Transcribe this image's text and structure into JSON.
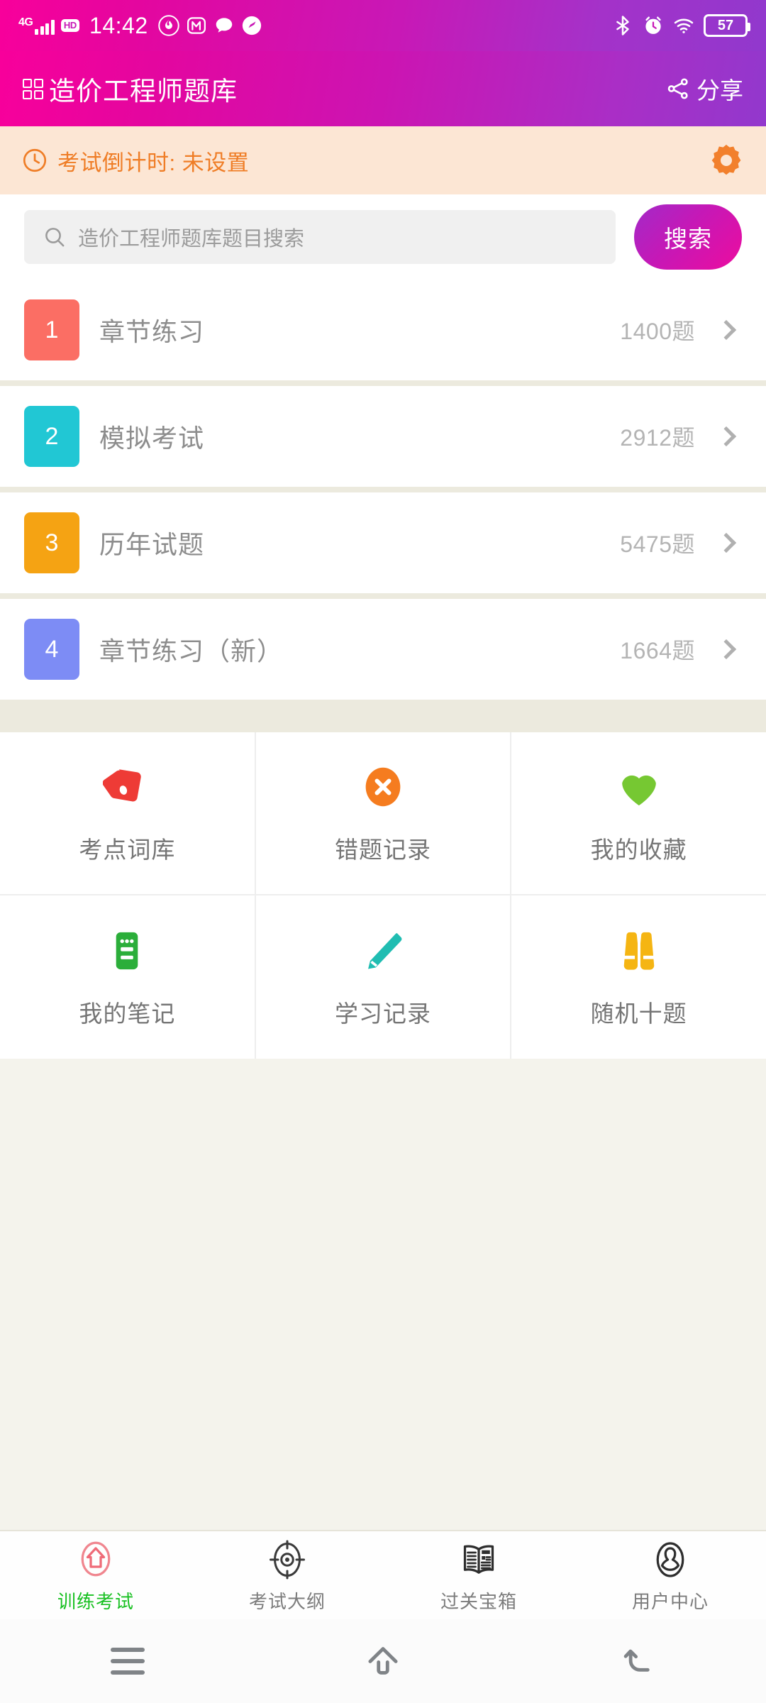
{
  "status_bar": {
    "network_type": "4G",
    "hd_label": "HD",
    "time": "14:42",
    "battery_level": "57",
    "icons": [
      "signal-bars-icon",
      "hd-icon",
      "flame-app-icon",
      "m-app-icon",
      "chat-bubble-icon",
      "speedometer-icon",
      "bluetooth-icon",
      "alarm-clock-icon",
      "wifi-icon",
      "battery-icon"
    ]
  },
  "app_bar": {
    "title": "造价工程师题库",
    "menu_icon": "grid-apps-icon",
    "share_label": "分享",
    "share_icon": "share-nodes-icon",
    "gradient_start": "#F8009B",
    "gradient_end": "#9138CD"
  },
  "countdown": {
    "text": "考试倒计时: 未设置",
    "clock_icon": "clock-icon",
    "settings_icon": "gear-icon",
    "bg_color": "#FCE6D4",
    "text_color": "#EF7D26"
  },
  "search": {
    "placeholder": "造价工程师题库题目搜索",
    "value": "",
    "icon": "search-icon",
    "button_label": "搜索"
  },
  "list": {
    "items": [
      {
        "index": "1",
        "title": "章节练习",
        "count": "1400题",
        "color": "#FB6E64"
      },
      {
        "index": "2",
        "title": "模拟考试",
        "count": "2912题",
        "color": "#21C7D4"
      },
      {
        "index": "3",
        "title": "历年试题",
        "count": "5475题",
        "color": "#F5A313"
      },
      {
        "index": "4",
        "title": "章节练习（新）",
        "count": "1664题",
        "color": "#7D8CF5"
      }
    ]
  },
  "grid": {
    "rows": [
      [
        {
          "label": "考点词库",
          "icon": "price-tag-icon",
          "color": "#EE3B36"
        },
        {
          "label": "错题记录",
          "icon": "circle-x-icon",
          "color": "#F57C1F"
        },
        {
          "label": "我的收藏",
          "icon": "heart-icon",
          "color": "#76C832"
        }
      ],
      [
        {
          "label": "我的笔记",
          "icon": "notepad-icon",
          "color": "#2BAE3A"
        },
        {
          "label": "学习记录",
          "icon": "pencil-icon",
          "color": "#20BDB2"
        },
        {
          "label": "随机十题",
          "icon": "binoculars-icon",
          "color": "#F5B513"
        }
      ]
    ]
  },
  "tab_bar": {
    "active_color": "#18C021",
    "inactive_color": "#7C7C7C",
    "tabs": [
      {
        "label": "训练考试",
        "icon": "home-icon",
        "active": true
      },
      {
        "label": "考试大纲",
        "icon": "target-icon",
        "active": false
      },
      {
        "label": "过关宝箱",
        "icon": "open-book-news-icon",
        "active": false
      },
      {
        "label": "用户中心",
        "icon": "user-person-icon",
        "active": false
      }
    ]
  },
  "system_nav": {
    "buttons": [
      {
        "icon": "menu-icon"
      },
      {
        "icon": "home-outline-icon"
      },
      {
        "icon": "back-arrow-icon"
      }
    ]
  }
}
